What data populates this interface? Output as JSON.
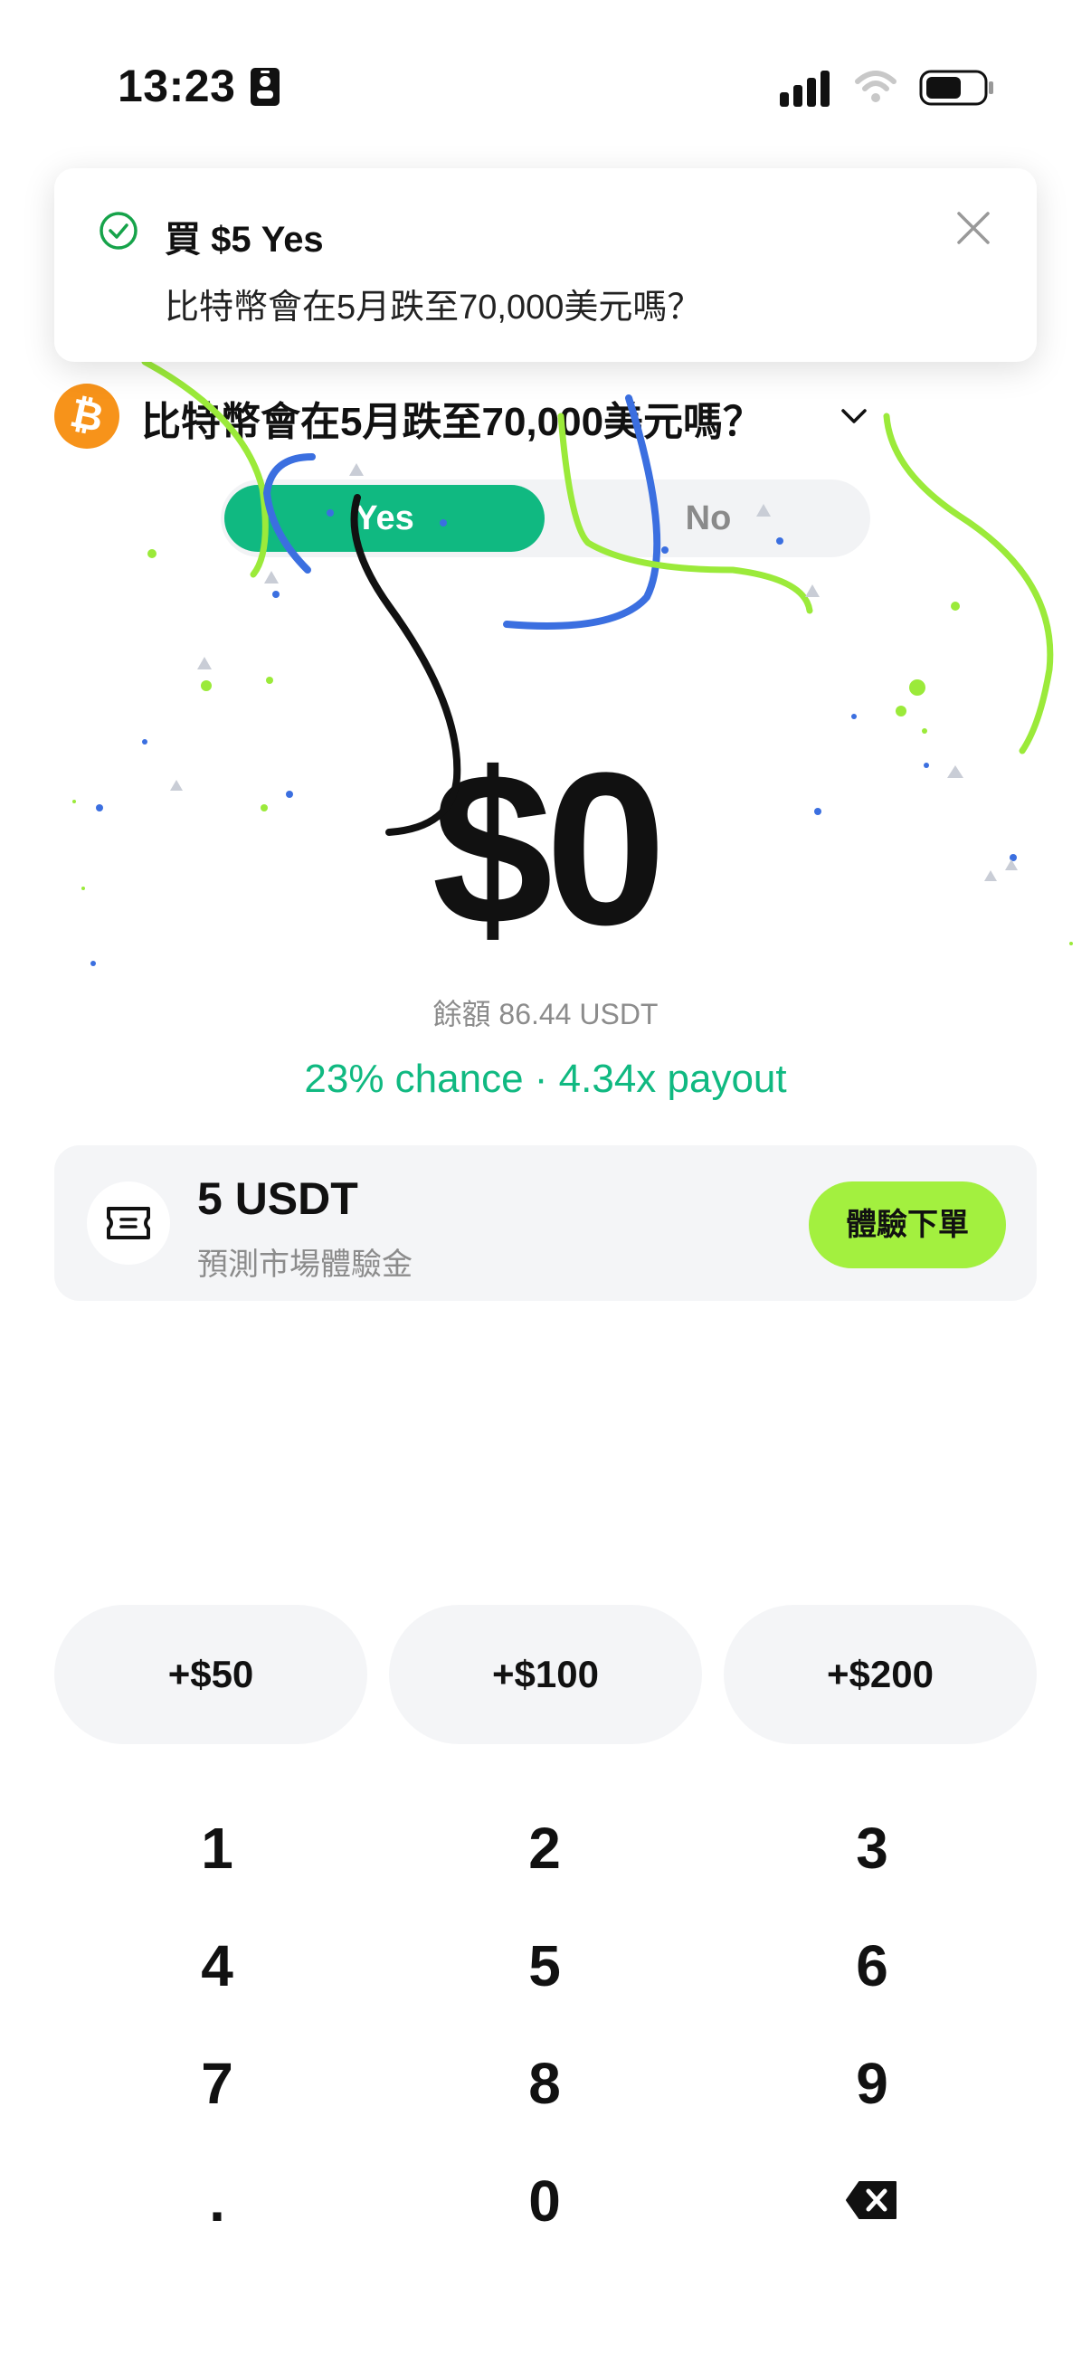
{
  "status_bar": {
    "time": "13:23",
    "icons": [
      "id-card-icon",
      "signal-icon",
      "wifi-icon",
      "battery-icon"
    ]
  },
  "toast": {
    "title": "買 $5 Yes",
    "subtitle": "比特幣會在5月跌至70,000美元嗎？",
    "icons": [
      "check-circle-icon",
      "close-icon"
    ]
  },
  "market": {
    "title": "比特幣會在5月跌至70,000美元嗎？",
    "coin_symbol": "₿"
  },
  "toggle": {
    "yes_label": "Yes",
    "no_label": "No",
    "selected": "Yes"
  },
  "order": {
    "amount": "$0",
    "balance": "餘額 86.44 USDT",
    "odds": "23% chance · 4.34x payout"
  },
  "voucher": {
    "amount": "5 USDT",
    "description": "預測市場體驗金",
    "button_label": "體驗下單"
  },
  "quick_add": [
    "+$50",
    "+$100",
    "+$200"
  ],
  "keypad": {
    "keys": [
      "1",
      "2",
      "3",
      "4",
      "5",
      "6",
      "7",
      "8",
      "9",
      ".",
      "0"
    ],
    "backspace_icon": "backspace-icon"
  },
  "colors": {
    "accent_green": "#10B981",
    "lime": "#A3F03F",
    "bitcoin_orange": "#F7931A",
    "confetti_blue": "#3B6FE0",
    "confetti_lime": "#9BEA3A"
  }
}
